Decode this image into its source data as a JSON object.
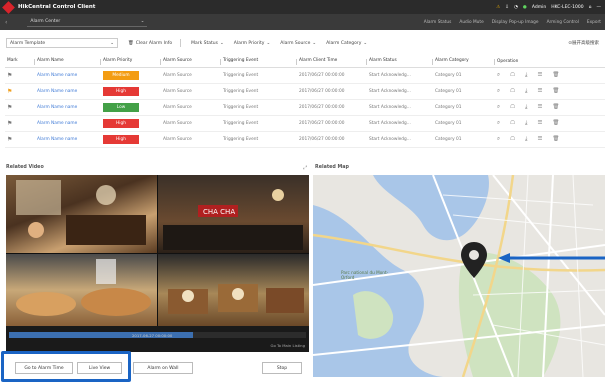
{
  "titlebar": {
    "app_title": "HikCentral Control Client",
    "user_label": "Admin",
    "device_label": "HKC-LEC-1000",
    "warn_icon": "warning-icon",
    "status_color": "#5fd35f"
  },
  "nav": {
    "tab_label": "Alarm Center",
    "actions": [
      "Alarm Status",
      "Audio Mute",
      "Display Pop-up Image",
      "Arming Control",
      "Export"
    ]
  },
  "toolbar": {
    "template": "Alarm Template",
    "clear": "Clear Alarm Info",
    "filters": [
      "Mark Status",
      "Alarm Priority",
      "Alarm Source",
      "Alarm Category"
    ],
    "expand": "展开高级搜索"
  },
  "table": {
    "headers": [
      "Mark",
      "Alarm Name",
      "Alarm Priority",
      "Alarm Source",
      "Triggering Event",
      "Alarm Client Time",
      "Alarm Status",
      "Alarm Category",
      "Operation"
    ],
    "rows": [
      {
        "name": "Alarm Name name",
        "priority": "Medium",
        "priority_color": "#f39c12",
        "source": "Alarm Source",
        "event": "Triggering Event",
        "time": "2017/06/27 00:00:00",
        "status": "Start Acknowledg...",
        "category": "Category 01",
        "flag_hot": false
      },
      {
        "name": "Alarm Name name",
        "priority": "High",
        "priority_color": "#e53935",
        "source": "Alarm Source",
        "event": "Triggering Event",
        "time": "2017/06/27 00:00:00",
        "status": "Start Acknowledg...",
        "category": "Category 01",
        "flag_hot": true
      },
      {
        "name": "Alarm Name name",
        "priority": "Low",
        "priority_color": "#43a047",
        "source": "Alarm Source",
        "event": "Triggering Event",
        "time": "2017/06/27 00:00:00",
        "status": "Start Acknowledg...",
        "category": "Category 01",
        "flag_hot": false
      },
      {
        "name": "Alarm Name name",
        "priority": "High",
        "priority_color": "#e53935",
        "source": "Alarm Source",
        "event": "Triggering Event",
        "time": "2017/06/27 00:00:00",
        "status": "Start Acknowledg...",
        "category": "Category 01",
        "flag_hot": false
      },
      {
        "name": "Alarm Name name",
        "priority": "High",
        "priority_color": "#e53935",
        "source": "Alarm Source",
        "event": "Triggering Event",
        "time": "2017/06/27 00:00:00",
        "status": "Start Acknowledg...",
        "category": "Category 01",
        "flag_hot": false
      }
    ]
  },
  "video": {
    "title": "Related Video",
    "timestamp": "2017-06-27 00:00:00",
    "playback_label": "Go To Main Listing",
    "progress_fraction": 0.62
  },
  "map": {
    "title": "Related Map",
    "place_label": "Parc national du Mont-Orford"
  },
  "buttons": {
    "go_to_alarm": "Go to Alarm Time",
    "live_view": "Live View",
    "alarm_on_wall": "Alarm on Wall",
    "stop": "Stop"
  },
  "accent_color": "#1a64c4"
}
